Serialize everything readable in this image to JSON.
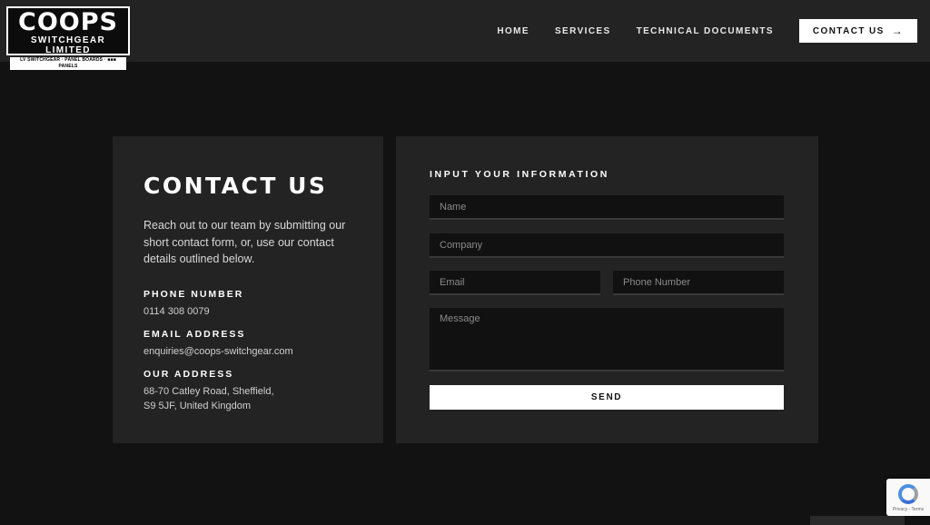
{
  "logo": {
    "main": "COOPS",
    "sub": "SWITCHGEAR LIMITED",
    "tagline": "LV SWITCHGEAR · PANEL BOARDS · ■■■ PANELS"
  },
  "nav": {
    "items": [
      "HOME",
      "SERVICES",
      "TECHNICAL DOCUMENTS"
    ],
    "cta_label": "CONTACT US",
    "cta_arrow": "→"
  },
  "contact": {
    "title": "CONTACT US",
    "intro": "Reach out to our team by submitting our short contact form, or, use our contact details outlined below.",
    "phone_label": "PHONE NUMBER",
    "phone": "0114 308 0079",
    "email_label": "EMAIL ADDRESS",
    "email": "enquiries@coops-switchgear.com",
    "address_label": "OUR ADDRESS",
    "address_line1": "68-70 Catley Road, Sheffield,",
    "address_line2": "S9 5JF, United Kingdom"
  },
  "form": {
    "heading": "INPUT YOUR INFORMATION",
    "name_placeholder": "Name",
    "company_placeholder": "Company",
    "email_placeholder": "Email",
    "phone_placeholder": "Phone Number",
    "message_placeholder": "Message",
    "send_label": "SEND"
  },
  "recaptcha": {
    "text": "Privacy - Terms"
  }
}
